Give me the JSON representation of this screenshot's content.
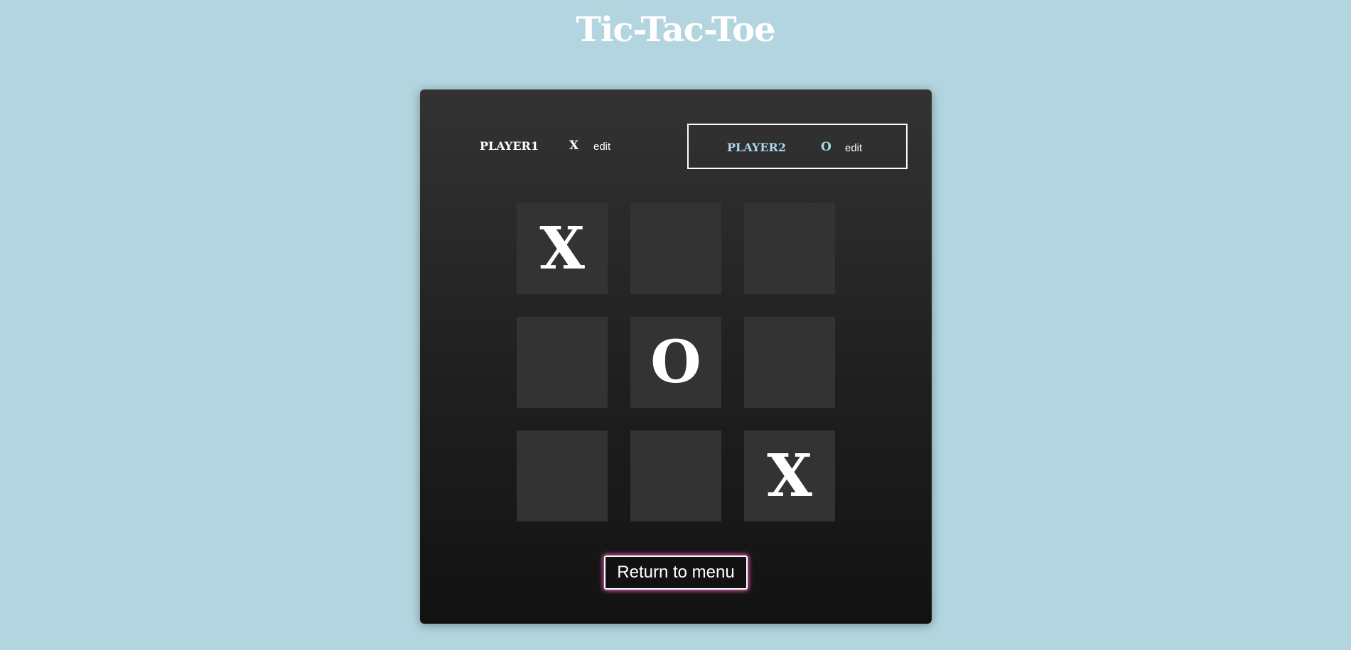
{
  "page": {
    "title": "Tic-Tac-Toe"
  },
  "players": [
    {
      "name": "PLAYER1",
      "symbol": "X",
      "edit_label": "edit",
      "active": false
    },
    {
      "name": "PLAYER2",
      "symbol": "O",
      "edit_label": "edit",
      "active": true
    }
  ],
  "board": {
    "cells": [
      "X",
      "",
      "",
      "",
      "O",
      "",
      "",
      "",
      "X"
    ]
  },
  "actions": {
    "return_label": "Return to menu"
  },
  "colors": {
    "background": "#b3d5df",
    "panel": "#1f1f1f",
    "cell": "#333333",
    "active_player": "#a9d9ec",
    "button_glow": "#ff69c8"
  }
}
